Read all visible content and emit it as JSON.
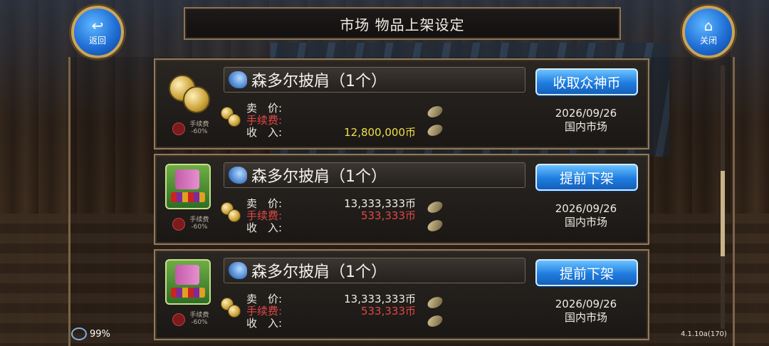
{
  "header": {
    "title": "市场 物品上架设定"
  },
  "nav": {
    "back_label": "返回",
    "close_label": "关闭",
    "back_icon": "return-arrow-icon",
    "close_icon": "home-icon"
  },
  "listings": [
    {
      "item_name": "森多尔披肩（1个）",
      "action_label": "收取众神币",
      "price_label": "卖　价:",
      "price_value": "",
      "fee_label": "手续费:",
      "fee_value": "",
      "income_label": "收　入:",
      "income_value": "12,800,000币",
      "date": "2026/09/26",
      "market": "国内市场",
      "fee_badge": "手续费",
      "fee_discount": "-60%",
      "thumb_icon": "gold-coins-icon"
    },
    {
      "item_name": "森多尔披肩（1个）",
      "action_label": "提前下架",
      "price_label": "卖　价:",
      "price_value": "13,333,333币",
      "fee_label": "手续费:",
      "fee_value": "533,333币",
      "income_label": "收　入:",
      "income_value": "",
      "date": "2026/09/26",
      "market": "国内市场",
      "fee_badge": "手续费",
      "fee_discount": "-60%",
      "thumb_icon": "market-stall-icon"
    },
    {
      "item_name": "森多尔披肩（1个）",
      "action_label": "提前下架",
      "price_label": "卖　价:",
      "price_value": "13,333,333币",
      "fee_label": "手续费:",
      "fee_value": "533,333币",
      "income_label": "收　入:",
      "income_value": "",
      "date": "2026/09/26",
      "market": "国内市场",
      "fee_badge": "手续费",
      "fee_discount": "-60%",
      "thumb_icon": "market-stall-icon"
    }
  ],
  "status": {
    "battery": "99%",
    "version": "4.1.10a(170)"
  },
  "colors": {
    "accent_blue": "#1f7ce0",
    "fee_red": "#e04848",
    "income_gold": "#f0e04a",
    "frame_gold": "#c9a55c"
  }
}
